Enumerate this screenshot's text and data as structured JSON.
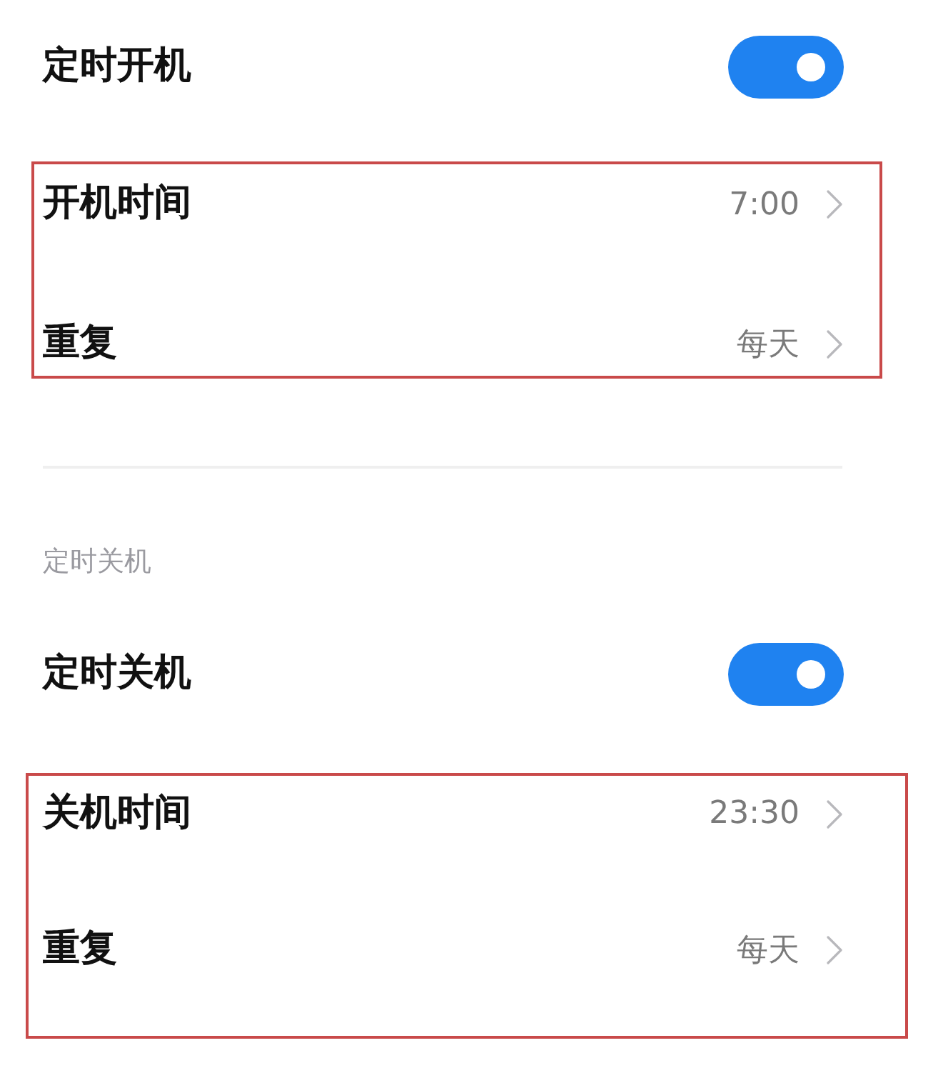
{
  "sections": [
    {
      "toggle": {
        "label": "定时开机",
        "on": true
      },
      "group": {
        "highlighted": true,
        "rows": [
          {
            "label": "开机时间",
            "value": "7:00"
          },
          {
            "label": "重复",
            "value": "每天"
          }
        ]
      }
    },
    {
      "header": "定时关机",
      "toggle": {
        "label": "定时关机",
        "on": true
      },
      "group": {
        "highlighted": true,
        "rows": [
          {
            "label": "关机时间",
            "value": "23:30"
          },
          {
            "label": "重复",
            "value": "每天"
          }
        ]
      }
    }
  ]
}
